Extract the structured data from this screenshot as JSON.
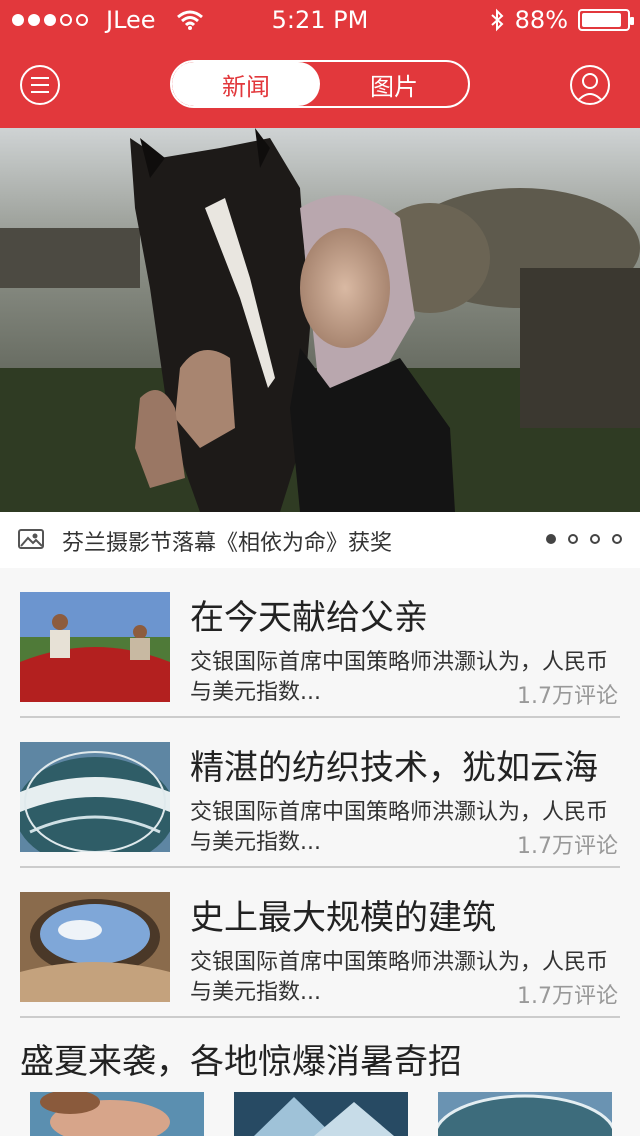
{
  "status_bar": {
    "carrier": "JLee",
    "time": "5:21 PM",
    "battery": "88%",
    "battery_level": 0.88,
    "signal_filled": 3,
    "signal_total": 5
  },
  "header": {
    "menu_icon": "menu-icon",
    "user_icon": "user-icon",
    "tabs": [
      {
        "label": "新闻",
        "active": true
      },
      {
        "label": "图片",
        "active": false
      }
    ]
  },
  "hero": {
    "caption": "芬兰摄影节落幕《相依为命》获奖",
    "caption_icon": "image-icon",
    "page_count": 4,
    "current_page": 1
  },
  "articles": [
    {
      "title": "在今天献给父亲",
      "summary": "交银国际首席中国策略师洪灏认为，人民币与美元指数...",
      "comments": "1.7万评论"
    },
    {
      "title": "精湛的纺织技术，犹如云海",
      "summary": "交银国际首席中国策略师洪灏认为，人民币与美元指数...",
      "comments": "1.7万评论"
    },
    {
      "title": "史上最大规模的建筑",
      "summary": "交银国际首席中国策略师洪灏认为，人民币与美元指数...",
      "comments": "1.7万评论"
    }
  ],
  "gallery_section": {
    "title": "盛夏来袭，各地惊爆消暑奇招"
  },
  "colors": {
    "brand_red": "#e2383c",
    "background": "#f7f7f7",
    "muted_text": "#999999"
  }
}
